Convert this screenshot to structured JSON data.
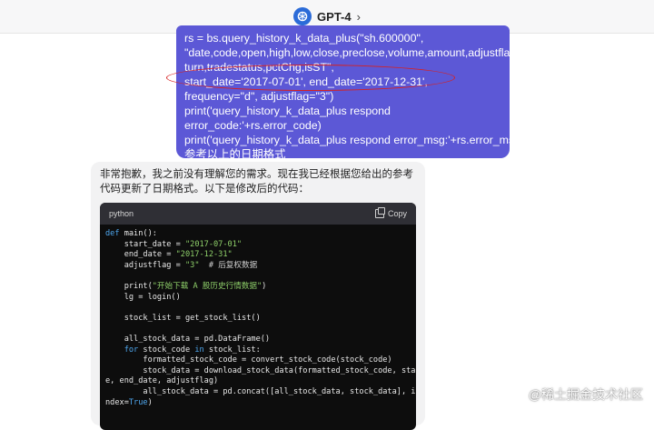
{
  "header": {
    "model_name": "GPT-4",
    "chevron": "›",
    "logo_icon": "openai-logo-icon",
    "logo_color": "#2b6bd8"
  },
  "user_message": {
    "bubble_color": "#5c58d6",
    "lines": [
      "rs = bs.query_history_k_data_plus(\"sh.600000\",",
      "\"date,code,open,high,low,close,preclose,volume,amount,adjustflag,",
      "turn,tradestatus,pctChg,isST\",",
      "start_date='2017-07-01', end_date='2017-12-31',",
      "frequency=\"d\", adjustflag=\"3\")",
      "print('query_history_k_data_plus respond",
      "error_code:'+rs.error_code)",
      "print('query_history_k_data_plus respond error_msg:'+rs.error_msg)",
      "参考以上的日期格式"
    ]
  },
  "assistant": {
    "text": "非常抱歉，我之前没有理解您的需求。现在我已经根据您给出的参考代码更新了日期格式。以下是修改后的代码：",
    "code": {
      "language": "python",
      "copy_label": "Copy",
      "copy_icon": "copy-icon",
      "lines": [
        "def main():",
        "    start_date = \"2017-07-01\"",
        "    end_date = \"2017-12-31\"",
        "    adjustflag = \"3\"  # 后复权数据",
        "",
        "    print(\"开始下载 A 股历史行情数据\")",
        "    lg = login()",
        "",
        "    stock_list = get_stock_list()",
        "",
        "    all_stock_data = pd.DataFrame()",
        "    for stock_code in stock_list:",
        "        formatted_stock_code = convert_stock_code(stock_code)",
        "        stock_data = download_stock_data(formatted_stock_code, start_dat",
        "e, end_date, adjustflag)",
        "        all_stock_data = pd.concat([all_stock_data, stock_data], ignore_i",
        "ndex=True)"
      ]
    }
  },
  "watermark": "@稀土掘金技术社区"
}
